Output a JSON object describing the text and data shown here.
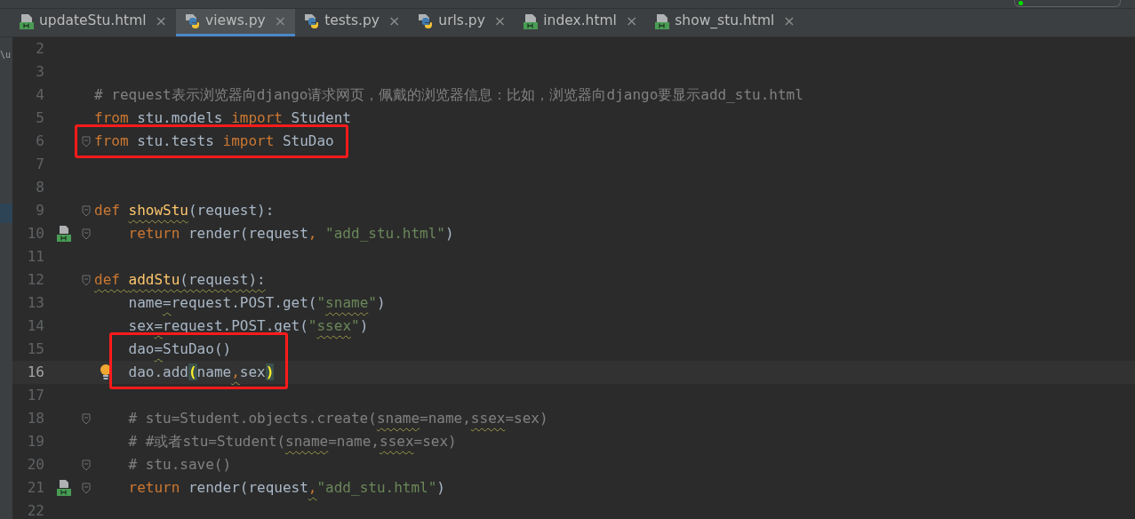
{
  "side_panel_text": "\\u",
  "tabs": [
    {
      "label": "updateStu.html",
      "kind": "html",
      "selected": false
    },
    {
      "label": "views.py",
      "kind": "python",
      "selected": true
    },
    {
      "label": "tests.py",
      "kind": "python",
      "selected": false
    },
    {
      "label": "urls.py",
      "kind": "python",
      "selected": false
    },
    {
      "label": "index.html",
      "kind": "html",
      "selected": false
    },
    {
      "label": "show_stu.html",
      "kind": "html",
      "selected": false
    }
  ],
  "tab_close": "×",
  "code_lines": [
    {
      "number": "2"
    },
    {
      "number": "3"
    },
    {
      "number": "4",
      "tokens": [
        {
          "kind": "comment",
          "text": "# request表示浏览器向django请求网页，佩戴的浏览器信息：比如，浏览器向django要显示add_stu.html"
        }
      ]
    },
    {
      "number": "5",
      "tokens": [
        {
          "kind": "keyword",
          "text": "from"
        },
        {
          "kind": "plain",
          "text": " stu.models "
        },
        {
          "kind": "keyword",
          "text": "import"
        },
        {
          "kind": "plain",
          "text": " Student"
        }
      ]
    },
    {
      "number": "6",
      "fold": true,
      "boxed": true,
      "tokens": [
        {
          "kind": "keyword",
          "text": "from"
        },
        {
          "kind": "plain",
          "text": " stu.tests "
        },
        {
          "kind": "keyword",
          "text": "import"
        },
        {
          "kind": "plain",
          "text": " StuDao"
        }
      ]
    },
    {
      "number": "7"
    },
    {
      "number": "8"
    },
    {
      "number": "9",
      "fold": true,
      "tokens": [
        {
          "kind": "keyword",
          "text": "def "
        },
        {
          "kind": "function",
          "text": "showStu",
          "squiggle": true
        },
        {
          "kind": "plain",
          "text": "(request):"
        }
      ],
      "children": [
        {
          "number": "10",
          "fold": true,
          "html_marker": true,
          "tokens": [
            {
              "kind": "keyword",
              "text": "return"
            },
            {
              "kind": "plain",
              "text": " render(request"
            },
            {
              "kind": "keyword",
              "text": ", "
            },
            {
              "kind": "string",
              "text": "\"add_stu.html\""
            },
            {
              "kind": "plain",
              "text": ")"
            }
          ]
        }
      ]
    },
    {
      "number": "11"
    },
    {
      "number": "12",
      "fold": true,
      "tokens": [
        {
          "kind": "keyword",
          "text": "def ",
          "squiggle": true
        },
        {
          "kind": "function",
          "text": "addStu",
          "squiggle": true
        },
        {
          "kind": "plain",
          "text": "(request):",
          "squiggle": true
        }
      ],
      "children": [
        {
          "number": "13",
          "tokens": [
            {
              "kind": "plain",
              "text": "name"
            },
            {
              "kind": "plain",
              "text": "=",
              "squiggle": true
            },
            {
              "kind": "plain",
              "text": "request.POST.get("
            },
            {
              "kind": "string",
              "text": "\""
            },
            {
              "kind": "string",
              "text": "sname",
              "squiggle": true
            },
            {
              "kind": "string",
              "text": "\""
            },
            {
              "kind": "plain",
              "text": ")"
            }
          ]
        },
        {
          "number": "14",
          "tokens": [
            {
              "kind": "plain",
              "text": "sex"
            },
            {
              "kind": "plain",
              "text": "=",
              "squiggle": true
            },
            {
              "kind": "plain",
              "text": "request.POST.get("
            },
            {
              "kind": "string",
              "text": "\""
            },
            {
              "kind": "string",
              "text": "ssex",
              "squiggle": true
            },
            {
              "kind": "string",
              "text": "\""
            },
            {
              "kind": "plain",
              "text": ")"
            }
          ]
        },
        {
          "number": "15",
          "boxed": true,
          "tokens": [
            {
              "kind": "plain",
              "text": "dao"
            },
            {
              "kind": "plain",
              "text": "=",
              "squiggle": true
            },
            {
              "kind": "plain",
              "text": "StuDao()"
            }
          ]
        },
        {
          "number": "16",
          "current": true,
          "bulb": true,
          "boxed": true,
          "tokens": [
            {
              "kind": "plain",
              "text": "dao.add"
            },
            {
              "kind": "brace_match",
              "text": "("
            },
            {
              "kind": "plain",
              "text": "name"
            },
            {
              "kind": "keyword",
              "text": ",",
              "squiggle": true
            },
            {
              "kind": "plain",
              "text": "sex"
            },
            {
              "kind": "brace_match",
              "text": ")"
            }
          ]
        },
        {
          "number": "17"
        },
        {
          "number": "18",
          "fold": true,
          "tokens": [
            {
              "kind": "comment",
              "text": "# stu=Student.objects.create("
            },
            {
              "kind": "comment",
              "text": "sname",
              "squiggle": true
            },
            {
              "kind": "comment",
              "text": "=name,"
            },
            {
              "kind": "comment",
              "text": "ssex",
              "squiggle": true
            },
            {
              "kind": "comment",
              "text": "=sex)"
            }
          ]
        },
        {
          "number": "19",
          "tokens": [
            {
              "kind": "comment",
              "text": "# #或者stu=Student("
            },
            {
              "kind": "comment",
              "text": "sname",
              "squiggle": true
            },
            {
              "kind": "comment",
              "text": "=name,"
            },
            {
              "kind": "comment",
              "text": "ssex",
              "squiggle": true
            },
            {
              "kind": "comment",
              "text": "=sex)"
            }
          ]
        },
        {
          "number": "20",
          "fold": true,
          "tokens": [
            {
              "kind": "comment",
              "text": "# stu.save()"
            }
          ]
        },
        {
          "number": "21",
          "fold": true,
          "html_marker": true,
          "tokens": [
            {
              "kind": "keyword",
              "text": "return"
            },
            {
              "kind": "plain",
              "text": " render(request"
            },
            {
              "kind": "keyword",
              "text": ",",
              "squiggle": true
            },
            {
              "kind": "string",
              "text": "\"add_stu.html\""
            },
            {
              "kind": "plain",
              "text": ")"
            }
          ]
        }
      ]
    },
    {
      "number": "22"
    }
  ]
}
